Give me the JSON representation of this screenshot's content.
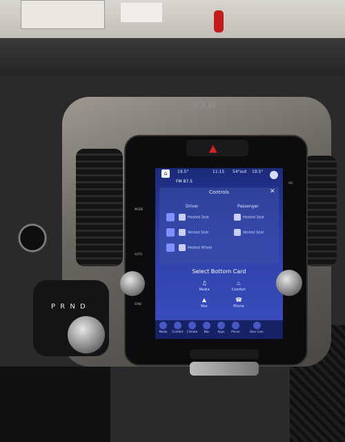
{
  "brand": "RAM",
  "screen": {
    "status_bar": {
      "temp_left": "19.5°",
      "time": "11:15",
      "temp_outside": "54°out",
      "temp_right": "19.5°"
    },
    "radio": "FM 87.5",
    "controls": {
      "title": "Controls",
      "driver_header": "Driver",
      "passenger_header": "Passenger",
      "driver_items": [
        "Heated Seat",
        "Vented Seat",
        "Heated Wheel"
      ],
      "passenger_items": [
        "Heated Seat",
        "Vented Seat"
      ]
    },
    "bottom_card": {
      "title": "Select Bottom Card",
      "options": [
        "Media",
        "Comfort",
        "Nav",
        "Phone"
      ]
    },
    "nav_bar": [
      "Media",
      "Comfort",
      "Climate",
      "Nav",
      "Apps",
      "Phone",
      "Rear Cam"
    ]
  },
  "gear_selector": "P R N D",
  "side_labels": {
    "left_top": "MODE",
    "left_mid": "AUTO",
    "left_low": "SYNC",
    "right_top": "A/C"
  },
  "colors": {
    "screen_accent": "#2d3fa8",
    "hazard": "#d82020"
  }
}
